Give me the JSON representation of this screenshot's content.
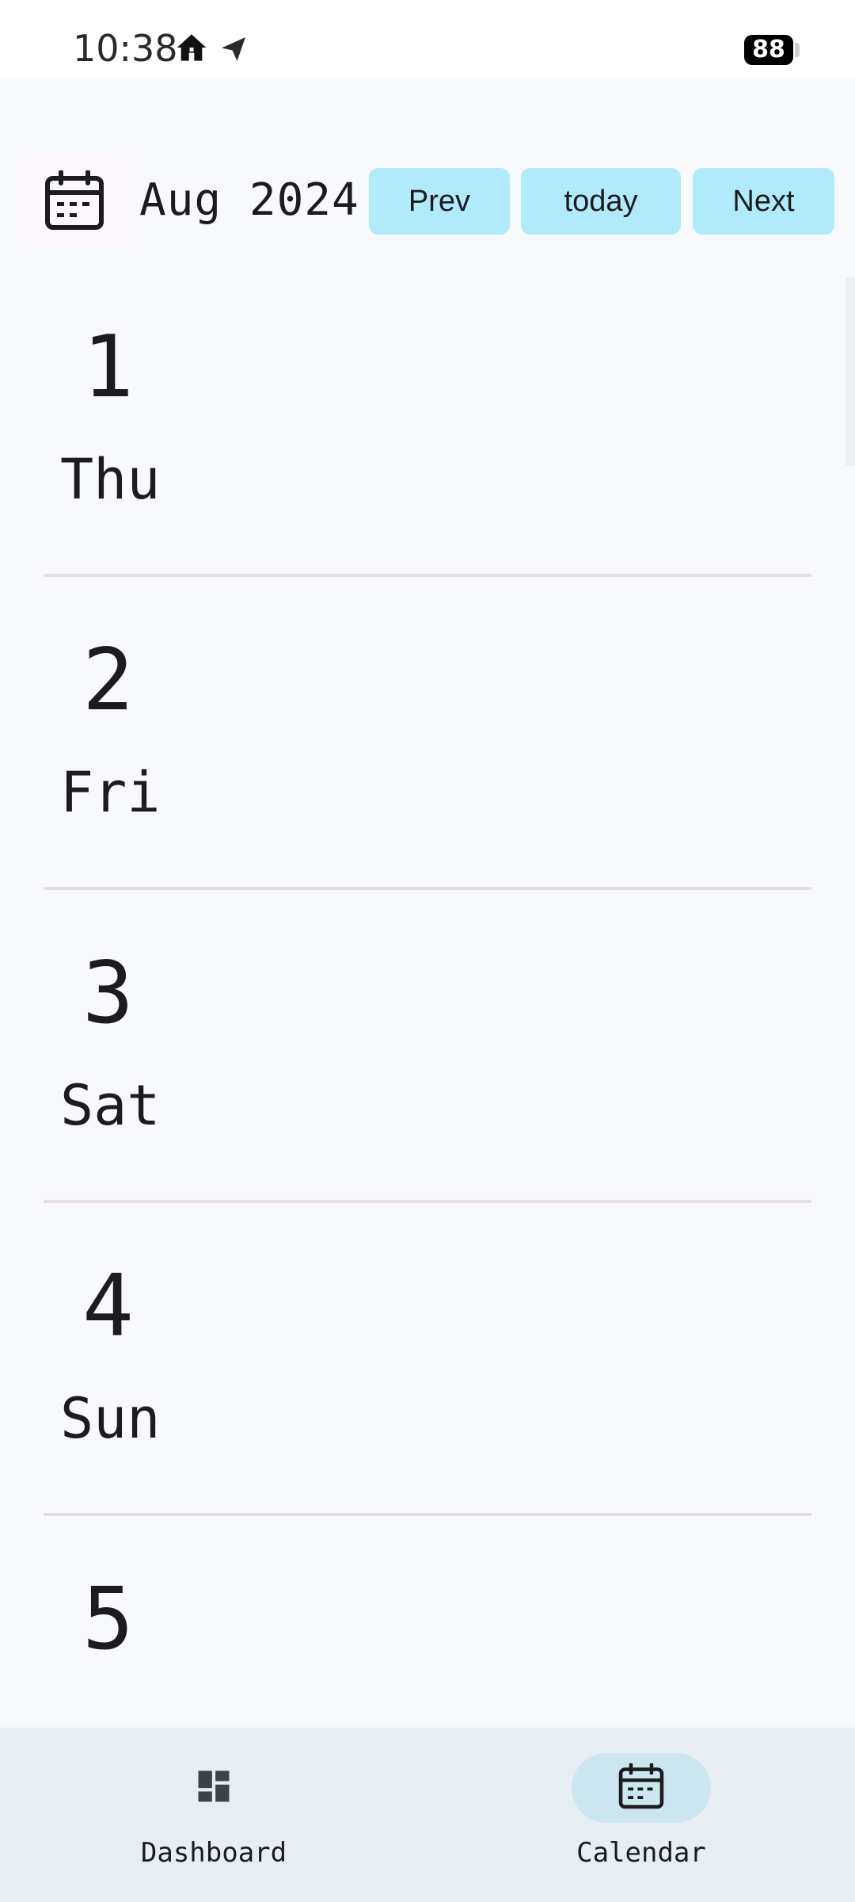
{
  "status_bar": {
    "time": "10:38",
    "battery": "88",
    "icons": [
      "home-icon",
      "send-icon"
    ]
  },
  "header": {
    "icon": "calendar-icon",
    "month": "Aug 2024",
    "prev_label": "Prev",
    "today_label": "today",
    "next_label": "Next"
  },
  "days": [
    {
      "number": "1",
      "name": "Thu"
    },
    {
      "number": "2",
      "name": "Fri"
    },
    {
      "number": "3",
      "name": "Sat"
    },
    {
      "number": "4",
      "name": "Sun"
    },
    {
      "number": "5",
      "name": ""
    }
  ],
  "bottom_nav": {
    "items": [
      {
        "label": "Dashboard",
        "icon": "dashboard-icon",
        "active": false
      },
      {
        "label": "Calendar",
        "icon": "calendar-icon",
        "active": true
      }
    ]
  },
  "colors": {
    "background": "#f8f9fb",
    "button": "#b1ebfb",
    "nav_background": "#e6edf3",
    "active_pill": "#cce6ef",
    "divider": "#e6dde6"
  }
}
